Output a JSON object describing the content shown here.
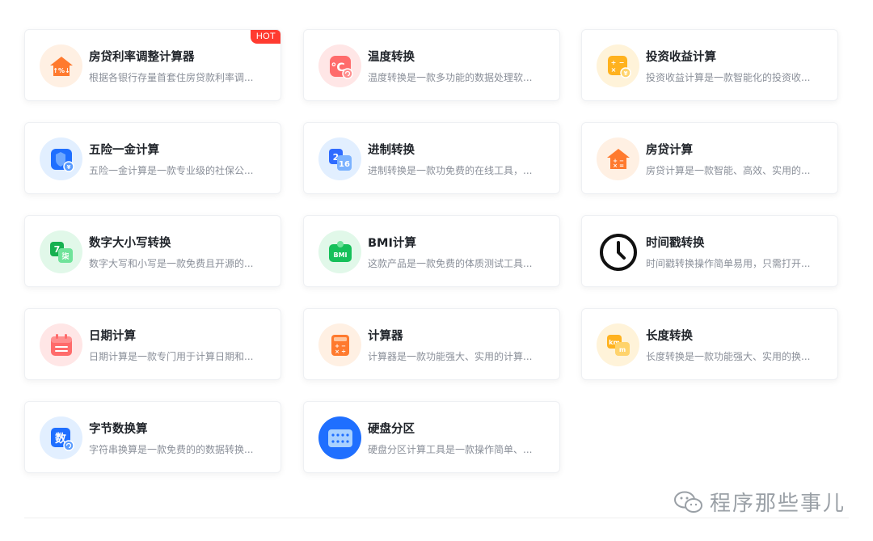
{
  "cards": [
    {
      "title": "房贷利率调整计算器",
      "desc": "根据各银行存量首套住房贷款利率调...",
      "icon": "house-percent-icon",
      "badge": "HOT",
      "color": "#ff7a2e",
      "bg": "#fff0e3"
    },
    {
      "title": "温度转换",
      "desc": "温度转换是一款多功能的数据处理软...",
      "icon": "temperature-icon",
      "color": "#ff5a5f",
      "bg": "#ffe6e6"
    },
    {
      "title": "投资收益计算",
      "desc": "投资收益计算是一款智能化的投资收...",
      "icon": "investment-calculator-icon",
      "color": "#ffb21e",
      "bg": "#fff3d9"
    },
    {
      "title": "五险一金计算",
      "desc": "五险一金计算是一款专业级的社保公...",
      "icon": "insurance-shield-icon",
      "color": "#1f7cff",
      "bg": "#e2efff"
    },
    {
      "title": "进制转换",
      "desc": "进制转换是一款功免费的在线工具，...",
      "icon": "base-convert-icon",
      "color": "#3a82ff",
      "bg": "#e2efff"
    },
    {
      "title": "房贷计算",
      "desc": "房贷计算是一款智能、高效、实用的...",
      "icon": "house-calculator-icon",
      "color": "#ff7a2e",
      "bg": "#fff0e3"
    },
    {
      "title": "数字大小写转换",
      "desc": "数字大写和小写是一款免费且开源的...",
      "icon": "number-case-icon",
      "color": "#22c55e",
      "bg": "#e1f8e9"
    },
    {
      "title": "BMI计算",
      "desc": "这款产品是一款免费的体质测试工具...",
      "icon": "bmi-scale-icon",
      "color": "#22c55e",
      "bg": "#e1f8e9"
    },
    {
      "title": "时间戳转换",
      "desc": "时间戳转换操作简单易用，只需打开...",
      "icon": "clock-icon",
      "color": "#111111",
      "bg": "#ffffff"
    },
    {
      "title": "日期计算",
      "desc": "日期计算是一款专门用于计算日期和...",
      "icon": "calendar-icon",
      "color": "#ff5a5f",
      "bg": "#ffe6e6"
    },
    {
      "title": "计算器",
      "desc": "计算器是一款功能强大、实用的计算...",
      "icon": "calculator-icon",
      "color": "#ff7a2e",
      "bg": "#fff0e3"
    },
    {
      "title": "长度转换",
      "desc": "长度转换是一款功能强大、实用的换...",
      "icon": "length-convert-icon",
      "color": "#ffb21e",
      "bg": "#fff3d9"
    },
    {
      "title": "字节数换算",
      "desc": "字符串换算是一款免费的的数据转换...",
      "icon": "byte-convert-icon",
      "color": "#1f7cff",
      "bg": "#e2efff"
    },
    {
      "title": "硬盘分区",
      "desc": "硬盘分区计算工具是一款操作简单、...",
      "icon": "disk-partition-icon",
      "color": "#1f7cff",
      "bg": "#e2efff"
    }
  ],
  "watermark": {
    "text": "程序那些事儿",
    "icon": "wechat-icon"
  }
}
